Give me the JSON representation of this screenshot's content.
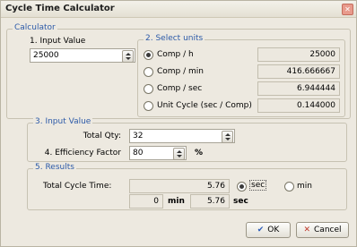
{
  "window": {
    "title": "Cycle Time Calculator",
    "close_glyph": "✕"
  },
  "calculator": {
    "legend": "Calculator",
    "input_value_label": "1. Input Value",
    "input_value": "25000",
    "units": {
      "legend": "2. Select units",
      "options": [
        {
          "label": "Comp / h",
          "value": "25000",
          "selected": true
        },
        {
          "label": "Comp / min",
          "value": "416.666667",
          "selected": false
        },
        {
          "label": "Comp / sec",
          "value": "6.944444",
          "selected": false
        },
        {
          "label": "Unit Cycle (sec / Comp)",
          "value": "0.144000",
          "selected": false
        }
      ]
    }
  },
  "input_section": {
    "legend": "3. Input Value",
    "total_qty_label": "Total Qty:",
    "total_qty": "32",
    "efficiency_label": "4. Efficiency Factor",
    "efficiency": "80",
    "efficiency_unit": "%"
  },
  "results": {
    "legend": "5. Results",
    "total_cycle_label": "Total Cycle Time:",
    "total_cycle_value": "5.76",
    "unit_sec_label": "sec",
    "unit_min_label": "min",
    "unit_selected": "sec",
    "minutes_value": "0",
    "min_text": "min",
    "seconds_value": "5.76",
    "sec_text": "sec"
  },
  "buttons": {
    "ok_label": "OK",
    "ok_icon": "check-icon",
    "cancel_label": "Cancel",
    "cancel_icon": "cross-icon"
  },
  "colors": {
    "legend_text": "#2c5aa8",
    "window_bg": "#ede9e0",
    "ok_check": "#2a5ab8",
    "cancel_cross": "#c0392b"
  }
}
